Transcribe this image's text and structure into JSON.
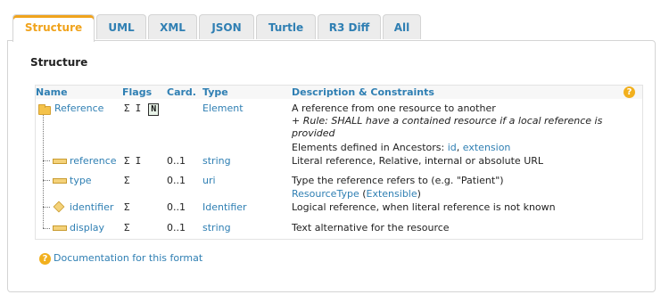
{
  "tabs": [
    "Structure",
    "UML",
    "XML",
    "JSON",
    "Turtle",
    "R3 Diff",
    "All"
  ],
  "panel_title": "Structure",
  "headers": {
    "name": "Name",
    "flags": "Flags",
    "card": "Card.",
    "type": "Type",
    "desc": "Description & Constraints"
  },
  "help_glyph": "?",
  "rows": [
    {
      "name": "Reference",
      "flags": [
        "Σ",
        "I"
      ],
      "flag_box": "N",
      "card": "",
      "type": "Element",
      "desc": "A reference from one resource to another",
      "rule": "+ Rule: SHALL have a contained resource if a local reference is",
      "rule2": "provided",
      "anc_label": "Elements defined in Ancestors: ",
      "anc1": "id",
      "anc_sep": ", ",
      "anc2": "extension"
    },
    {
      "name": "reference",
      "flags": [
        "Σ",
        "I"
      ],
      "card": "0..1",
      "type": "string",
      "desc": "Literal reference, Relative, internal or absolute URL"
    },
    {
      "name": "type",
      "flags": [
        "Σ"
      ],
      "card": "0..1",
      "type": "uri",
      "desc": "Type the reference refers to (e.g. \"Patient\")",
      "sub1": "ResourceType",
      "sub2": " (",
      "sub3": "Extensible",
      "sub4": ")"
    },
    {
      "name": "identifier",
      "flags": [
        "Σ"
      ],
      "card": "0..1",
      "type": "Identifier",
      "desc": "Logical reference, when literal reference is not known"
    },
    {
      "name": "display",
      "flags": [
        "Σ"
      ],
      "card": "0..1",
      "type": "string",
      "desc": "Text alternative for the resource"
    }
  ],
  "doc_link": "Documentation for this format",
  "colors": {
    "accent": "#f0a31c",
    "link": "#2f7fb3"
  }
}
